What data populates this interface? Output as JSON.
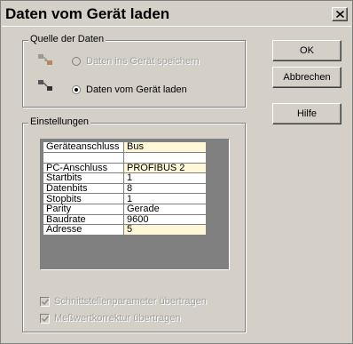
{
  "window": {
    "title": "Daten vom Gerät laden"
  },
  "source_group": {
    "legend": "Quelle der Daten",
    "options": [
      {
        "label": "Daten ins Gerät speichern",
        "checked": false,
        "enabled": false
      },
      {
        "label": "Daten vom Gerät laden",
        "checked": true,
        "enabled": true
      }
    ]
  },
  "buttons": {
    "ok": "OK",
    "cancel": "Abbrechen",
    "help": "Hilfe"
  },
  "settings_group": {
    "legend": "Einstellungen",
    "rows": [
      {
        "key": "Geräteanschluss",
        "value": "Bus"
      },
      {
        "key": "",
        "value": ""
      },
      {
        "key": "PC-Anschluss",
        "value": "PROFIBUS 2"
      },
      {
        "key": "Startbits",
        "value": "1"
      },
      {
        "key": "Datenbits",
        "value": "8"
      },
      {
        "key": "Stopbits",
        "value": "1"
      },
      {
        "key": "Parity",
        "value": "Gerade"
      },
      {
        "key": "Baudrate",
        "value": "9600"
      },
      {
        "key": "Adresse",
        "value": "5"
      }
    ],
    "checkboxes": [
      {
        "label": "Schnittstellenparameter übertragen",
        "checked": true,
        "enabled": false
      },
      {
        "label": "Meßwertkorrektur übertragen",
        "checked": true,
        "enabled": false
      }
    ]
  }
}
